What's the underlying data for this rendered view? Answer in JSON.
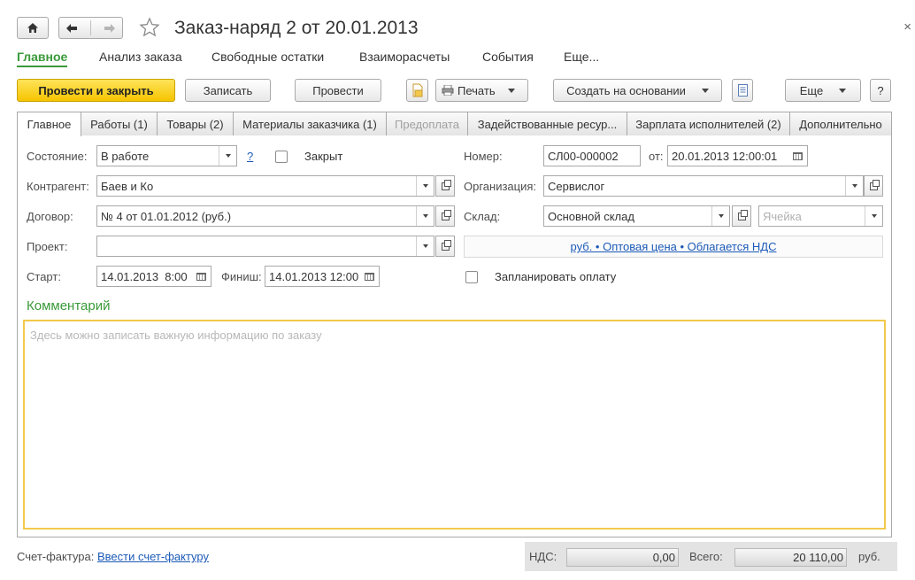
{
  "window": {
    "title": "Заказ-наряд 2 от 20.01.2013",
    "close_glyph": "×"
  },
  "sections": [
    "Главное",
    "Анализ заказа",
    "Свободные остатки",
    "Взаиморасчеты",
    "События",
    "Еще..."
  ],
  "toolbar": {
    "post_close": "Провести и закрыть",
    "save": "Записать",
    "post": "Провести",
    "print": "Печать",
    "create_based": "Создать на основании",
    "more": "Еще",
    "help": "?"
  },
  "tabs": [
    "Главное",
    "Работы (1)",
    "Товары (2)",
    "Материалы заказчика (1)",
    "Предоплата",
    "Задействованные ресур...",
    "Зарплата исполнителей (2)",
    "Дополнительно"
  ],
  "form": {
    "state_label": "Состояние:",
    "state_value": "В работе",
    "state_help": "?",
    "closed_label": "Закрыт",
    "number_label": "Номер:",
    "number_value": "СЛ00-000002",
    "date_from_label": "от:",
    "date_value": "20.01.2013 12:00:01",
    "counterparty_label": "Контрагент:",
    "counterparty_value": "Баев и Ко",
    "organization_label": "Организация:",
    "organization_value": "Сервислог",
    "contract_label": "Договор:",
    "contract_value": "№ 4 от 01.01.2012 (руб.)",
    "warehouse_label": "Склад:",
    "warehouse_value": "Основной склад",
    "cell_placeholder": "Ячейка",
    "project_label": "Проект:",
    "project_value": "",
    "price_info": "руб. • Оптовая цена • Облагается НДС",
    "start_label": "Старт:",
    "start_value": "14.01.2013  8:00",
    "finish_label": "Финиш:",
    "finish_value": "14.01.2013 12:00",
    "plan_payment_label": "Запланировать оплату",
    "comment_heading": "Комментарий",
    "comment_placeholder": "Здесь можно записать важную информацию по заказу"
  },
  "footer": {
    "invoice_label": "Счет-фактура:",
    "invoice_link": "Ввести счет-фактуру",
    "vat_label": "НДС:",
    "vat_value": "0,00",
    "total_label": "Всего:",
    "total_value": "20 110,00",
    "currency": "руб."
  },
  "colors": {
    "accent_green": "#3a9a3a",
    "primary_button": "#f5c400",
    "link_blue": "#1c5ab7",
    "comment_border": "#f2c94c"
  }
}
